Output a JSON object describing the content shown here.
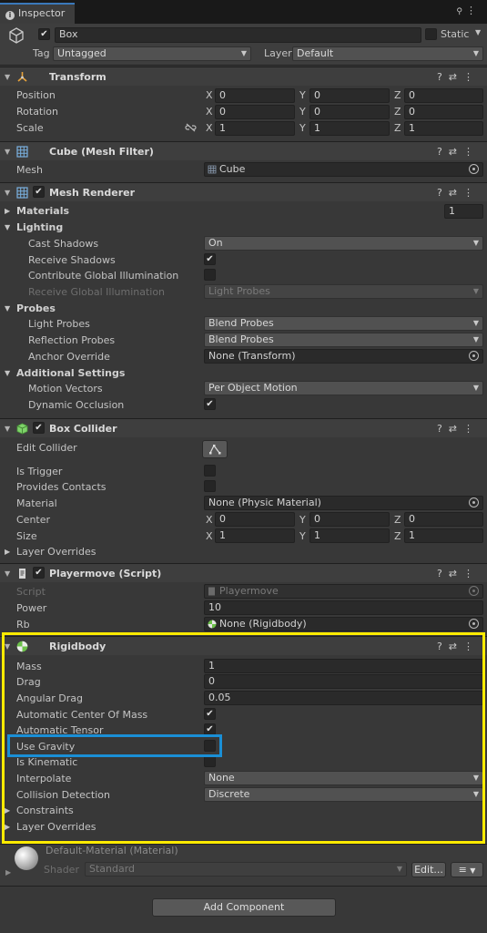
{
  "tab": {
    "title": "Inspector"
  },
  "gameobject": {
    "active": true,
    "name": "Box",
    "static_label": "Static",
    "tag_label": "Tag",
    "tag_value": "Untagged",
    "layer_label": "Layer",
    "layer_value": "Default"
  },
  "transform": {
    "title": "Transform",
    "rows": [
      {
        "label": "Position",
        "x": "0",
        "y": "0",
        "z": "0"
      },
      {
        "label": "Rotation",
        "x": "0",
        "y": "0",
        "z": "0"
      },
      {
        "label": "Scale",
        "x": "1",
        "y": "1",
        "z": "1"
      }
    ]
  },
  "axis": {
    "x": "X",
    "y": "Y",
    "z": "Z"
  },
  "mesh_filter": {
    "title": "Cube (Mesh Filter)",
    "mesh_label": "Mesh",
    "mesh_value": "Cube"
  },
  "mesh_renderer": {
    "title": "Mesh Renderer",
    "materials_label": "Materials",
    "materials_count": "1",
    "lighting_label": "Lighting",
    "cast_shadows_label": "Cast Shadows",
    "cast_shadows_value": "On",
    "receive_shadows_label": "Receive Shadows",
    "contribute_gi_label": "Contribute Global Illumination",
    "receive_gi_label": "Receive Global Illumination",
    "receive_gi_value": "Light Probes",
    "probes_label": "Probes",
    "light_probes_label": "Light Probes",
    "light_probes_value": "Blend Probes",
    "reflection_probes_label": "Reflection Probes",
    "reflection_probes_value": "Blend Probes",
    "anchor_override_label": "Anchor Override",
    "anchor_override_value": "None (Transform)",
    "additional_label": "Additional Settings",
    "motion_vectors_label": "Motion Vectors",
    "motion_vectors_value": "Per Object Motion",
    "dynamic_occlusion_label": "Dynamic Occlusion"
  },
  "box_collider": {
    "title": "Box Collider",
    "edit_collider_label": "Edit Collider",
    "is_trigger_label": "Is Trigger",
    "provides_contacts_label": "Provides Contacts",
    "material_label": "Material",
    "material_value": "None (Physic Material)",
    "center_label": "Center",
    "center": {
      "x": "0",
      "y": "0",
      "z": "0"
    },
    "size_label": "Size",
    "size": {
      "x": "1",
      "y": "1",
      "z": "1"
    },
    "layer_overrides_label": "Layer Overrides"
  },
  "playermove": {
    "title": "Playermove (Script)",
    "script_label": "Script",
    "script_value": "Playermove",
    "power_label": "Power",
    "power_value": "10",
    "rb_label": "Rb",
    "rb_value": "None (Rigidbody)"
  },
  "rigidbody": {
    "title": "Rigidbody",
    "mass_label": "Mass",
    "mass_value": "1",
    "drag_label": "Drag",
    "drag_value": "0",
    "angular_drag_label": "Angular Drag",
    "angular_drag_value": "0.05",
    "auto_com_label": "Automatic Center Of Mass",
    "auto_tensor_label": "Automatic Tensor",
    "use_gravity_label": "Use Gravity",
    "is_kinematic_label": "Is Kinematic",
    "interpolate_label": "Interpolate",
    "interpolate_value": "None",
    "collision_label": "Collision Detection",
    "collision_value": "Discrete",
    "constraints_label": "Constraints",
    "layer_overrides_label": "Layer Overrides"
  },
  "material": {
    "name": "Default-Material (Material)",
    "shader_label": "Shader",
    "shader_value": "Standard",
    "edit_label": "Edit..."
  },
  "add_component_label": "Add Component",
  "glyphs": {
    "check": "✔",
    "tri_down": "▼",
    "tri_right": "▶",
    "help": "?",
    "settings": "⇄",
    "more": "⋮",
    "lock": "🔒",
    "caret": "▾"
  },
  "highlight_colors": {
    "component_box": "#ffeb00",
    "field_box": "#1a8fd6"
  }
}
